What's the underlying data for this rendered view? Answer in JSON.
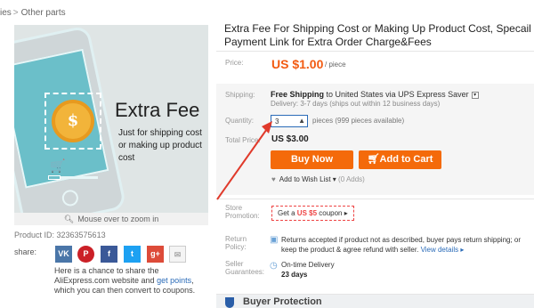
{
  "breadcrumb": {
    "prev": "ies",
    "current": "Other parts"
  },
  "image": {
    "title": "Extra Fee",
    "description": "Just for shipping cost or making up product cost",
    "coin_symbol": "$",
    "zoom_hint": "Mouse over to zoom in"
  },
  "product_id": "Product ID: 32363575613",
  "share": {
    "label": "share:",
    "buttons": [
      "VK",
      "P",
      "f",
      "t",
      "g+",
      "✉"
    ],
    "note_prefix": "Here is a chance to share the AliExpress.com website and ",
    "note_link": "get points",
    "note_suffix": ", which you can then convert to coupons."
  },
  "product": {
    "title": "Extra Fee For Shipping Cost or Making Up Product Cost, Specail Payment Link for Extra Order Charge&Fees"
  },
  "price": {
    "label": "Price:",
    "value": "US $1.00",
    "unit": "/ piece"
  },
  "shipping": {
    "label": "Shipping:",
    "free": "Free Shipping",
    "to": "to United States via UPS Express Saver",
    "delivery": "Delivery: 3-7 days (ships out within 12 business days)"
  },
  "quantity": {
    "label": "Quantity:",
    "value": "3",
    "note": "pieces (999 pieces available)"
  },
  "total": {
    "label": "Total Price:",
    "value": "US $3.00"
  },
  "actions": {
    "buy_now": "Buy Now",
    "add_to_cart": "Add to Cart",
    "wishlist": "Add to Wish List",
    "wishlist_count": "(0 Adds)"
  },
  "promotion": {
    "label": "Store Promotion:",
    "coupon_prefix": "Get a ",
    "coupon_value": "US $5",
    "coupon_suffix": " coupon ▸"
  },
  "returns": {
    "label": "Return Policy:",
    "text": "Returns accepted if product not as described, buyer pays return shipping; or keep the product & agree refund with seller.",
    "link": "View details ▸"
  },
  "guarantees": {
    "label": "Seller Guarantees:",
    "ontime": "On-time Delivery",
    "days": "23 days"
  },
  "buyer_protection": {
    "label": "Buyer Protection"
  },
  "colors": {
    "accent": "#f46a0a",
    "price": "#f25b12",
    "link": "#2a6bb8",
    "annotation": "#e03a2b"
  }
}
